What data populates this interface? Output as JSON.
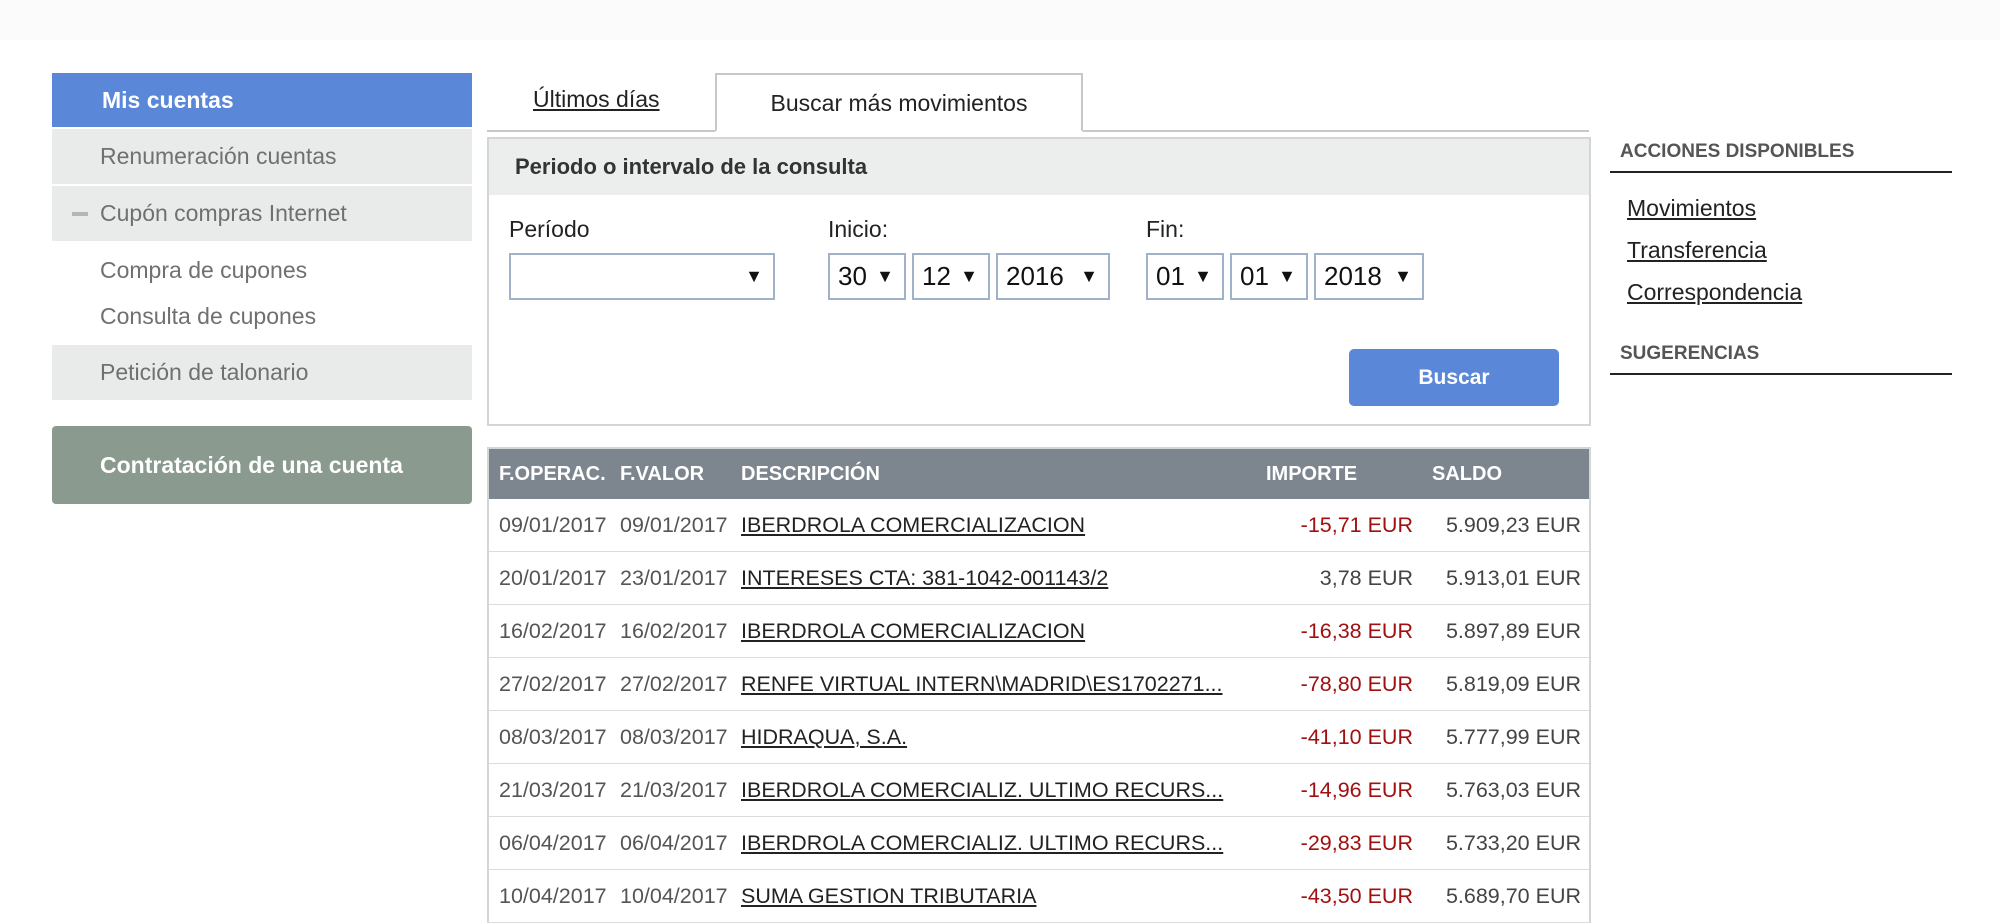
{
  "sidebar": {
    "header": "Mis cuentas",
    "items": [
      {
        "label": "Renumeración cuentas"
      },
      {
        "label": "Cupón compras Internet"
      }
    ],
    "subitems": [
      {
        "label": "Compra de cupones"
      },
      {
        "label": "Consulta de cupones"
      }
    ],
    "item_last": {
      "label": "Petición de talonario"
    },
    "cta_button": "Contratación de una cuenta"
  },
  "tabs": {
    "recent": "Últimos días",
    "search": "Buscar más movimientos"
  },
  "query": {
    "title": "Periodo o intervalo de la consulta",
    "periodo_label": "Período",
    "periodo_value": "",
    "inicio_label": "Inicio:",
    "inicio": {
      "day": "30",
      "month": "12",
      "year": "2016"
    },
    "fin_label": "Fin:",
    "fin": {
      "day": "01",
      "month": "01",
      "year": "2018"
    },
    "arrow": "▼",
    "submit": "Buscar"
  },
  "table": {
    "headers": {
      "f_operac": "F.OPERAC.",
      "f_valor": "F.VALOR",
      "descripcion": "DESCRIPCIÓN",
      "importe": "IMPORTE",
      "saldo": "SALDO"
    },
    "rows": [
      {
        "op": "09/01/2017",
        "val": "09/01/2017",
        "desc": "IBERDROLA COMERCIALIZACION",
        "imp": "-15,71 EUR",
        "saldo": "5.909,23 EUR"
      },
      {
        "op": "20/01/2017",
        "val": "23/01/2017",
        "desc": "INTERESES CTA: 381-1042-001143/2",
        "imp": "3,78 EUR",
        "saldo": "5.913,01 EUR"
      },
      {
        "op": "16/02/2017",
        "val": "16/02/2017",
        "desc": "IBERDROLA COMERCIALIZACION",
        "imp": "-16,38 EUR",
        "saldo": "5.897,89 EUR"
      },
      {
        "op": "27/02/2017",
        "val": "27/02/2017",
        "desc": "RENFE VIRTUAL INTERN\\MADRID\\ES1702271...",
        "imp": "-78,80 EUR",
        "saldo": "5.819,09 EUR"
      },
      {
        "op": "08/03/2017",
        "val": "08/03/2017",
        "desc": "HIDRAQUA, S.A.",
        "imp": "-41,10 EUR",
        "saldo": "5.777,99 EUR"
      },
      {
        "op": "21/03/2017",
        "val": "21/03/2017",
        "desc": "IBERDROLA COMERCIALIZ. ULTIMO RECURS...",
        "imp": "-14,96 EUR",
        "saldo": "5.763,03 EUR"
      },
      {
        "op": "06/04/2017",
        "val": "06/04/2017",
        "desc": "IBERDROLA COMERCIALIZ. ULTIMO RECURS...",
        "imp": "-29,83 EUR",
        "saldo": "5.733,20 EUR"
      },
      {
        "op": "10/04/2017",
        "val": "10/04/2017",
        "desc": "SUMA GESTION TRIBUTARIA",
        "imp": "-43,50 EUR",
        "saldo": "5.689,70 EUR"
      }
    ]
  },
  "right": {
    "acciones_title": "ACCIONES DISPONIBLES",
    "acciones": [
      "Movimientos",
      "Transferencia",
      "Correspondencia"
    ],
    "sugerencias_title": "SUGERENCIAS"
  },
  "colors": {
    "accent": "#5a87d8",
    "negative": "#a01010",
    "table_header": "#7d868e",
    "cta": "#8a9a8f"
  }
}
